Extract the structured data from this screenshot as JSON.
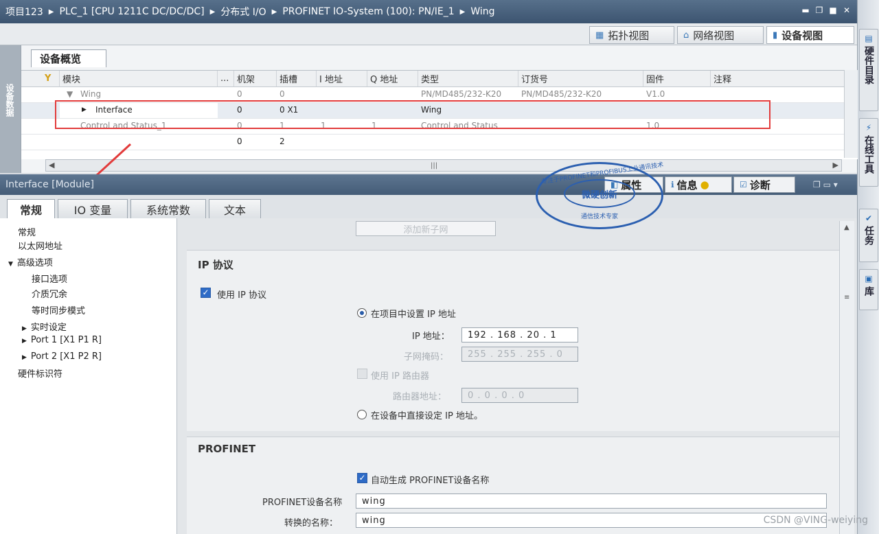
{
  "breadcrumb": [
    "项目123",
    "PLC_1 [CPU 1211C DC/DC/DC]",
    "分布式 I/O",
    "PROFINET IO-System (100): PN/IE_1",
    "Wing"
  ],
  "view_tabs": {
    "topology": "拓扑视图",
    "network": "网络视图",
    "device": "设备视图"
  },
  "right_panel": {
    "hardware_catalog": "硬件目录",
    "online_tools": "在线工具",
    "tasks": "任务",
    "libraries": "库"
  },
  "left_gutter": "设备数据",
  "overview": {
    "tab": "设备概览",
    "columns": [
      "模块",
      "...",
      "机架",
      "插槽",
      "I 地址",
      "Q 地址",
      "类型",
      "订货号",
      "固件",
      "注释"
    ],
    "rows": [
      {
        "module": "Wing",
        "rack": "0",
        "slot": "0",
        "iaddr": "",
        "qaddr": "",
        "type": "PN/MD485/232-K20",
        "order": "PN/MD485/232-K20",
        "fw": "V1.0"
      },
      {
        "module": "Interface",
        "rack": "0",
        "slot": "0 X1",
        "iaddr": "",
        "qaddr": "",
        "type": "Wing",
        "order": "",
        "fw": ""
      },
      {
        "module": "Control and Status_1",
        "rack": "0",
        "slot": "1",
        "iaddr": "1",
        "qaddr": "1",
        "type": "Control and Status",
        "order": "",
        "fw": "1.0"
      },
      {
        "module": "",
        "rack": "0",
        "slot": "2",
        "iaddr": "",
        "qaddr": "",
        "type": "",
        "order": "",
        "fw": ""
      }
    ]
  },
  "properties": {
    "title": "Interface [Module]",
    "tabs": {
      "properties": "属性",
      "info": "信息",
      "diagnostics": "诊断"
    }
  },
  "sub_tabs": [
    "常规",
    "IO 变量",
    "系统常数",
    "文本"
  ],
  "nav": {
    "general": "常规",
    "ethernet": "以太网地址",
    "advanced": "高级选项",
    "interface_options": "接口选项",
    "media_redundancy": "介质冗余",
    "isochronous": "等时同步模式",
    "realtime": "实时设定",
    "port1": "Port 1 [X1 P1 R]",
    "port2": "Port 2 [X1 P2 R]",
    "hw_id": "硬件标识符"
  },
  "ip": {
    "add_subnet": "添加新子网",
    "section_title": "IP 协议",
    "use_ip": "使用 IP 协议",
    "set_in_project": "在项目中设置 IP 地址",
    "ip_label": "IP 地址：",
    "ip_value": "192 . 168 . 20 . 1",
    "mask_label": "子网掩码：",
    "mask_value": "255 . 255 . 255 . 0",
    "use_router": "使用 IP 路由器",
    "router_label": "路由器地址：",
    "router_value": "0 . 0 . 0 . 0",
    "set_on_device": "在设备中直接设定 IP 地址。"
  },
  "profinet": {
    "section_title": "PROFINET",
    "auto_generate": "自动生成 PROFINET设备名称",
    "name_label": "PROFINET设备名称",
    "name_value": "wing",
    "converted_label": "转换的名称：",
    "converted_value": "wing"
  },
  "stamp": {
    "center": "微硬创新",
    "top": "专注于PROFINET和PROFIBUS工业通讯技术",
    "bottom": "通信技术专家"
  },
  "watermark": "CSDN @VING-weiying",
  "colors": {
    "highlight": "#e23b3b",
    "accent": "#2e6bc6",
    "titlebar": "#3c5470"
  }
}
